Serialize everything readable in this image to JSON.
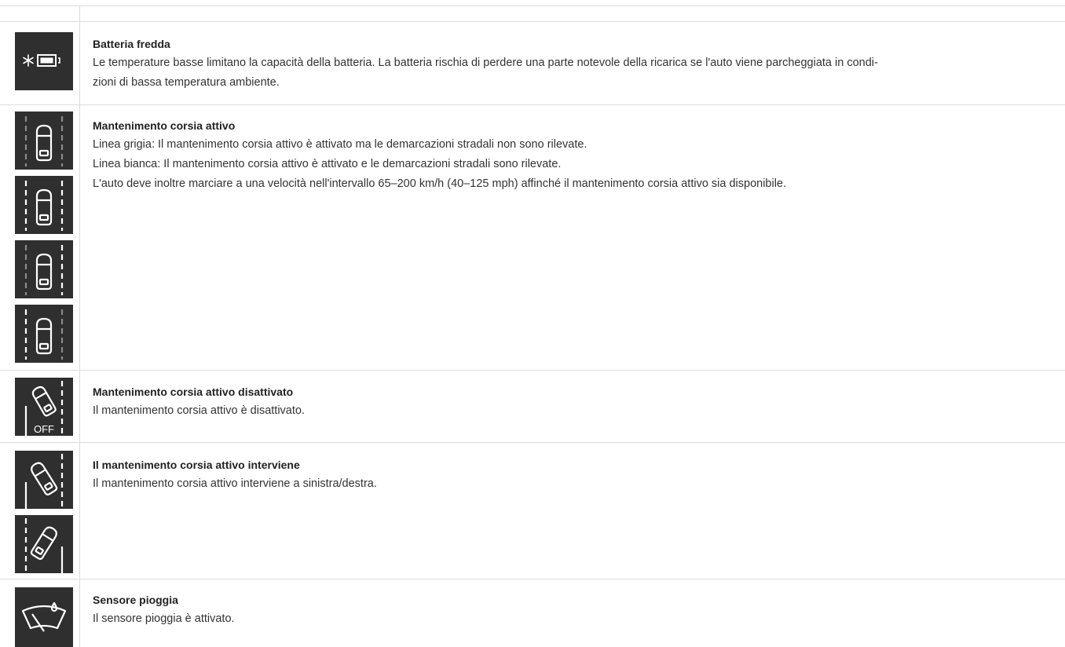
{
  "rows": [
    {
      "title": "Batteria fredda",
      "lines": [
        "Le temperature basse limitano la capacità della batteria. La batteria rischia di perdere una parte notevole della ricarica se l'auto viene parcheggiata in condi-",
        "zioni di bassa temperatura ambiente."
      ],
      "icons": [
        "cold-battery-icon"
      ]
    },
    {
      "title": "Mantenimento corsia attivo",
      "lines": [
        "Linea grigia: Il mantenimento corsia attivo è attivato ma le demarcazioni stradali non sono rilevate.",
        "Linea bianca: Il mantenimento corsia attivo è attivato e le demarcazioni stradali sono rilevate.",
        "L'auto deve inoltre marciare a una velocità nell'intervallo 65–200 km/h (40–125 mph) affinché il mantenimento corsia attivo sia disponibile."
      ],
      "icons": [
        "lane-keeping-grey-lines-icon",
        "lane-keeping-white-lines-icon",
        "lane-keeping-right-white-line-icon",
        "lane-keeping-left-white-line-icon"
      ]
    },
    {
      "title": "Mantenimento corsia attivo disattivato",
      "lines": [
        "Il mantenimento corsia attivo è disattivato."
      ],
      "icons": [
        "lane-keeping-off-icon"
      ],
      "icon_text": "OFF"
    },
    {
      "title": "Il mantenimento corsia attivo interviene",
      "lines": [
        "Il mantenimento corsia attivo interviene a sinistra/destra."
      ],
      "icons": [
        "lane-keeping-intervene-left-icon",
        "lane-keeping-intervene-right-icon"
      ]
    },
    {
      "title": "Sensore pioggia",
      "lines": [
        "Il sensore pioggia è attivato."
      ],
      "icons": [
        "rain-sensor-icon"
      ]
    }
  ],
  "colors": {
    "icon_bg": "#2f2f2f",
    "icon_fg": "#ffffff",
    "grey_line": "#8a8a8a",
    "border": "#dcdcdc"
  }
}
